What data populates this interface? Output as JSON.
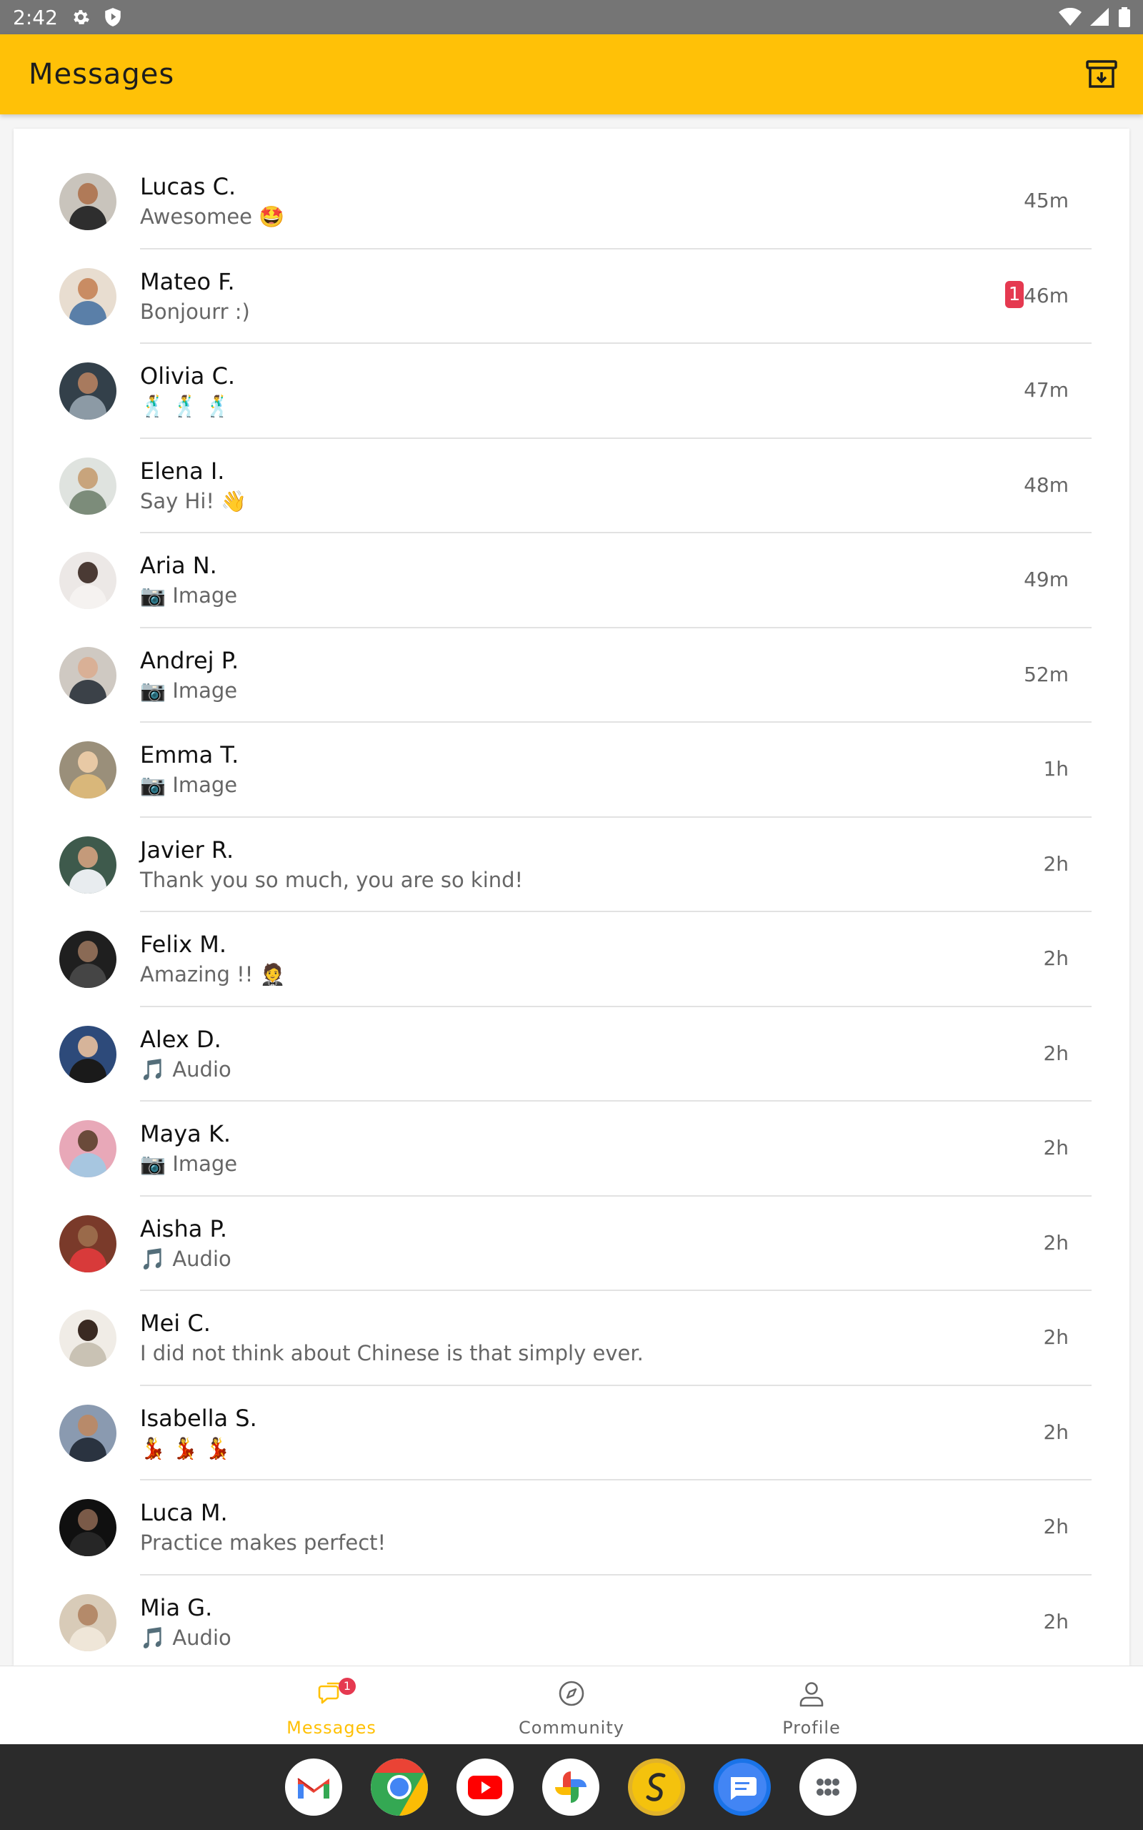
{
  "status_bar": {
    "time": "2:42"
  },
  "app_bar": {
    "title": "Messages"
  },
  "conversations": [
    {
      "name": "Lucas C.",
      "preview": "Awesomee 🤩",
      "time": "45m",
      "unread": ""
    },
    {
      "name": "Mateo F.",
      "preview": "Bonjourr :)",
      "time": "46m",
      "unread": "1"
    },
    {
      "name": "Olivia C.",
      "preview": "🕺 🕺 🕺",
      "time": "47m",
      "unread": ""
    },
    {
      "name": "Elena I.",
      "preview": "Say Hi! 👋",
      "time": "48m",
      "unread": ""
    },
    {
      "name": "Aria N.",
      "preview": "📷 Image",
      "time": "49m",
      "unread": ""
    },
    {
      "name": "Andrej P.",
      "preview": "📷 Image",
      "time": "52m",
      "unread": ""
    },
    {
      "name": "Emma T.",
      "preview": "📷 Image",
      "time": "1h",
      "unread": ""
    },
    {
      "name": "Javier R.",
      "preview": "Thank you so much, you are so kind!",
      "time": "2h",
      "unread": ""
    },
    {
      "name": "Felix M.",
      "preview": "Amazing !! 🤵",
      "time": "2h",
      "unread": ""
    },
    {
      "name": "Alex D.",
      "preview": "🎵 Audio",
      "time": "2h",
      "unread": ""
    },
    {
      "name": "Maya K.",
      "preview": "📷 Image",
      "time": "2h",
      "unread": ""
    },
    {
      "name": "Aisha P.",
      "preview": "🎵 Audio",
      "time": "2h",
      "unread": ""
    },
    {
      "name": "Mei C.",
      "preview": "I did not think about Chinese is that simply ever.",
      "time": "2h",
      "unread": ""
    },
    {
      "name": "Isabella S.",
      "preview": "💃 💃 💃",
      "time": "2h",
      "unread": ""
    },
    {
      "name": "Luca M.",
      "preview": "Practice makes perfect!",
      "time": "2h",
      "unread": ""
    },
    {
      "name": "Mia G.",
      "preview": "🎵 Audio",
      "time": "2h",
      "unread": ""
    }
  ],
  "bottom_nav": {
    "messages": {
      "label": "Messages",
      "badge": "1"
    },
    "community": {
      "label": "Community"
    },
    "profile": {
      "label": "Profile"
    }
  },
  "dock_apps": [
    "Gmail",
    "Chrome",
    "YouTube",
    "Photos",
    "Language app",
    "Messages",
    "App drawer"
  ],
  "colors": {
    "accent": "#ffc107",
    "badge": "#e53950"
  }
}
